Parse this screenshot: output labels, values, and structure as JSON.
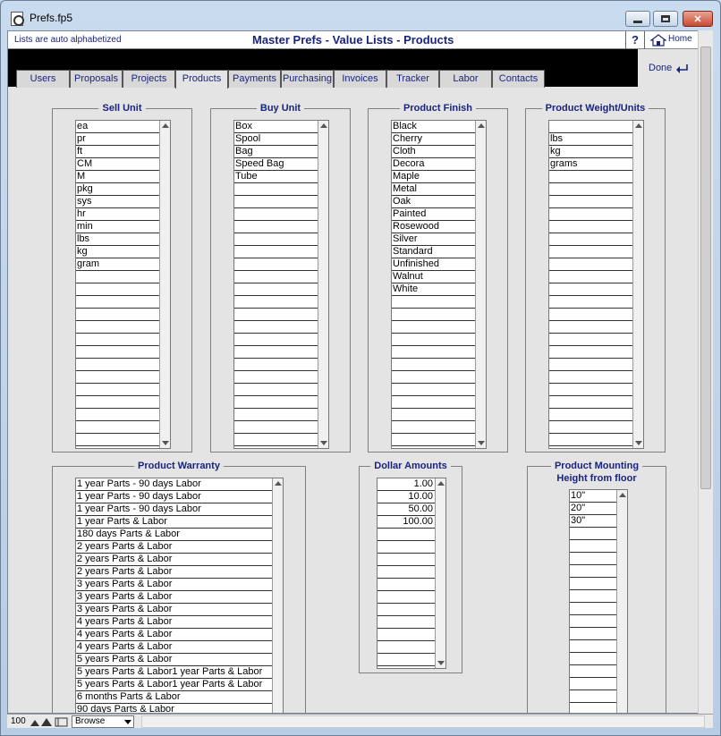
{
  "window": {
    "title": "Prefs.fp5"
  },
  "infobar": {
    "note": "Lists are auto alphabetized",
    "page_title": "Master Prefs - Value Lists - Products",
    "help_label": "?",
    "home_label": "Home"
  },
  "tabs": [
    {
      "label": "Users"
    },
    {
      "label": "Proposals"
    },
    {
      "label": "Projects"
    },
    {
      "label": "Products",
      "active": true
    },
    {
      "label": "Payments"
    },
    {
      "label": "Purchasing"
    },
    {
      "label": "Invoices"
    },
    {
      "label": "Tracker"
    },
    {
      "label": "Labor"
    },
    {
      "label": "Contacts"
    }
  ],
  "done_label": "Done",
  "lists": {
    "sell_unit": {
      "title": "Sell Unit",
      "items": [
        "ea",
        "pr",
        "ft",
        "CM",
        "M",
        "pkg",
        "sys",
        "hr",
        "min",
        "lbs",
        "kg",
        "gram"
      ]
    },
    "buy_unit": {
      "title": "Buy Unit",
      "items": [
        "Box",
        "Spool",
        "Bag",
        "Speed Bag",
        "Tube"
      ]
    },
    "product_finish": {
      "title": "Product Finish",
      "items": [
        "Black",
        "Cherry",
        "Cloth",
        "Decora",
        "Maple",
        "Metal",
        "Oak",
        "Painted",
        "Rosewood",
        "Silver",
        "Standard",
        "Unfinished",
        "Walnut",
        "White"
      ]
    },
    "product_weight": {
      "title": "Product Weight/Units",
      "items": [
        "",
        "lbs",
        "kg",
        "grams"
      ]
    },
    "product_warranty": {
      "title": "Product Warranty",
      "items": [
        "1 year Parts - 90 days Labor",
        "1 year Parts - 90 days Labor",
        "1 year Parts - 90 days Labor",
        "1 year Parts & Labor",
        "180 days Parts & Labor",
        "2 years Parts & Labor",
        "2 years Parts & Labor",
        "2 years Parts & Labor",
        "3 years Parts & Labor",
        "3 years Parts & Labor",
        "3 years Parts & Labor",
        "4 years Parts & Labor",
        "4 years Parts & Labor",
        "4 years Parts & Labor",
        "5 years Parts & Labor",
        "5 years Parts & Labor1 year Parts & Labor",
        "5 years Parts & Labor1 year Parts & Labor",
        "6 months Parts & Labor",
        "90 days Parts & Labor"
      ]
    },
    "dollar_amounts": {
      "title": "Dollar Amounts",
      "items": [
        "1.00",
        "10.00",
        "50.00",
        "100.00"
      ]
    },
    "mounting_height": {
      "title_line1": "Product Mounting",
      "title_line2": "Height from floor",
      "items": [
        "10\"",
        "20\"",
        "30\""
      ]
    }
  },
  "status": {
    "zoom": "100",
    "mode": "Browse"
  }
}
